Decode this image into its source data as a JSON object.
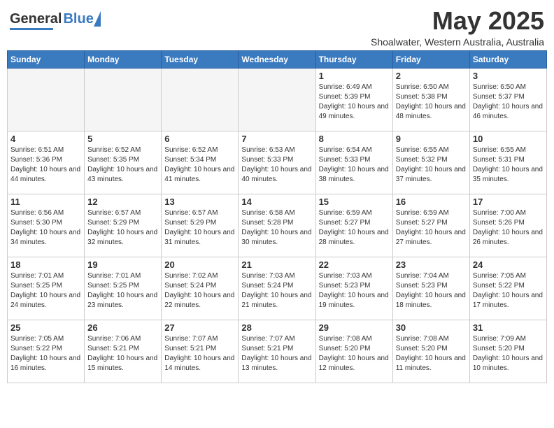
{
  "header": {
    "logo_general": "General",
    "logo_blue": "Blue",
    "month": "May 2025",
    "location": "Shoalwater, Western Australia, Australia"
  },
  "weekdays": [
    "Sunday",
    "Monday",
    "Tuesday",
    "Wednesday",
    "Thursday",
    "Friday",
    "Saturday"
  ],
  "weeks": [
    [
      {
        "day": "",
        "empty": true
      },
      {
        "day": "",
        "empty": true
      },
      {
        "day": "",
        "empty": true
      },
      {
        "day": "",
        "empty": true
      },
      {
        "day": "1",
        "sunrise": "6:49 AM",
        "sunset": "5:39 PM",
        "daylight": "10 hours and 49 minutes."
      },
      {
        "day": "2",
        "sunrise": "6:50 AM",
        "sunset": "5:38 PM",
        "daylight": "10 hours and 48 minutes."
      },
      {
        "day": "3",
        "sunrise": "6:50 AM",
        "sunset": "5:37 PM",
        "daylight": "10 hours and 46 minutes."
      }
    ],
    [
      {
        "day": "4",
        "sunrise": "6:51 AM",
        "sunset": "5:36 PM",
        "daylight": "10 hours and 44 minutes."
      },
      {
        "day": "5",
        "sunrise": "6:52 AM",
        "sunset": "5:35 PM",
        "daylight": "10 hours and 43 minutes."
      },
      {
        "day": "6",
        "sunrise": "6:52 AM",
        "sunset": "5:34 PM",
        "daylight": "10 hours and 41 minutes."
      },
      {
        "day": "7",
        "sunrise": "6:53 AM",
        "sunset": "5:33 PM",
        "daylight": "10 hours and 40 minutes."
      },
      {
        "day": "8",
        "sunrise": "6:54 AM",
        "sunset": "5:33 PM",
        "daylight": "10 hours and 38 minutes."
      },
      {
        "day": "9",
        "sunrise": "6:55 AM",
        "sunset": "5:32 PM",
        "daylight": "10 hours and 37 minutes."
      },
      {
        "day": "10",
        "sunrise": "6:55 AM",
        "sunset": "5:31 PM",
        "daylight": "10 hours and 35 minutes."
      }
    ],
    [
      {
        "day": "11",
        "sunrise": "6:56 AM",
        "sunset": "5:30 PM",
        "daylight": "10 hours and 34 minutes."
      },
      {
        "day": "12",
        "sunrise": "6:57 AM",
        "sunset": "5:29 PM",
        "daylight": "10 hours and 32 minutes."
      },
      {
        "day": "13",
        "sunrise": "6:57 AM",
        "sunset": "5:29 PM",
        "daylight": "10 hours and 31 minutes."
      },
      {
        "day": "14",
        "sunrise": "6:58 AM",
        "sunset": "5:28 PM",
        "daylight": "10 hours and 30 minutes."
      },
      {
        "day": "15",
        "sunrise": "6:59 AM",
        "sunset": "5:27 PM",
        "daylight": "10 hours and 28 minutes."
      },
      {
        "day": "16",
        "sunrise": "6:59 AM",
        "sunset": "5:27 PM",
        "daylight": "10 hours and 27 minutes."
      },
      {
        "day": "17",
        "sunrise": "7:00 AM",
        "sunset": "5:26 PM",
        "daylight": "10 hours and 26 minutes."
      }
    ],
    [
      {
        "day": "18",
        "sunrise": "7:01 AM",
        "sunset": "5:25 PM",
        "daylight": "10 hours and 24 minutes."
      },
      {
        "day": "19",
        "sunrise": "7:01 AM",
        "sunset": "5:25 PM",
        "daylight": "10 hours and 23 minutes."
      },
      {
        "day": "20",
        "sunrise": "7:02 AM",
        "sunset": "5:24 PM",
        "daylight": "10 hours and 22 minutes."
      },
      {
        "day": "21",
        "sunrise": "7:03 AM",
        "sunset": "5:24 PM",
        "daylight": "10 hours and 21 minutes."
      },
      {
        "day": "22",
        "sunrise": "7:03 AM",
        "sunset": "5:23 PM",
        "daylight": "10 hours and 19 minutes."
      },
      {
        "day": "23",
        "sunrise": "7:04 AM",
        "sunset": "5:23 PM",
        "daylight": "10 hours and 18 minutes."
      },
      {
        "day": "24",
        "sunrise": "7:05 AM",
        "sunset": "5:22 PM",
        "daylight": "10 hours and 17 minutes."
      }
    ],
    [
      {
        "day": "25",
        "sunrise": "7:05 AM",
        "sunset": "5:22 PM",
        "daylight": "10 hours and 16 minutes."
      },
      {
        "day": "26",
        "sunrise": "7:06 AM",
        "sunset": "5:21 PM",
        "daylight": "10 hours and 15 minutes."
      },
      {
        "day": "27",
        "sunrise": "7:07 AM",
        "sunset": "5:21 PM",
        "daylight": "10 hours and 14 minutes."
      },
      {
        "day": "28",
        "sunrise": "7:07 AM",
        "sunset": "5:21 PM",
        "daylight": "10 hours and 13 minutes."
      },
      {
        "day": "29",
        "sunrise": "7:08 AM",
        "sunset": "5:20 PM",
        "daylight": "10 hours and 12 minutes."
      },
      {
        "day": "30",
        "sunrise": "7:08 AM",
        "sunset": "5:20 PM",
        "daylight": "10 hours and 11 minutes."
      },
      {
        "day": "31",
        "sunrise": "7:09 AM",
        "sunset": "5:20 PM",
        "daylight": "10 hours and 10 minutes."
      }
    ]
  ]
}
